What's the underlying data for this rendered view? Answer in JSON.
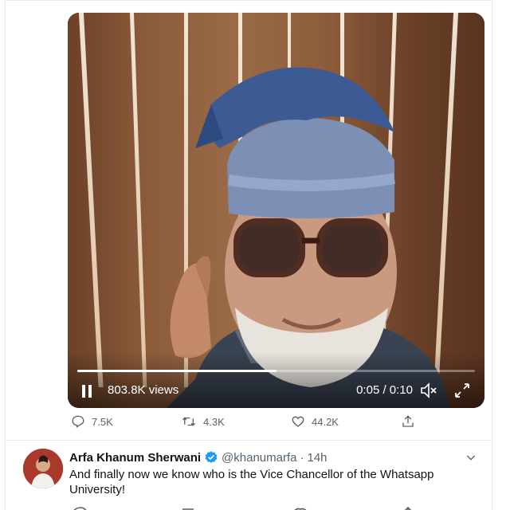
{
  "video": {
    "views": "803.8K views",
    "time": "0:05 / 0:10",
    "progress": 0.5
  },
  "actions": {
    "replies": "7.5K",
    "retweets": "4.3K",
    "likes": "44.2K"
  },
  "reply_tweet": {
    "name": "Arfa Khanum Sherwani",
    "handle": "@khanumarfa",
    "separator": "·",
    "time": "14h",
    "text": "And finally now we know who is the Vice Chancellor of the Whatsapp University!"
  },
  "colors": {
    "muted": "#536471",
    "verified": "#1d9bf0",
    "divider": "#e6ecf0"
  }
}
